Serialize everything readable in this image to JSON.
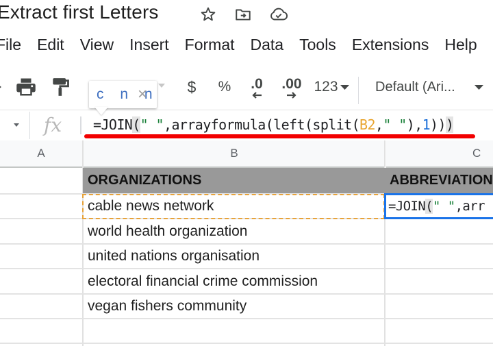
{
  "document": {
    "title": "Extract first Letters",
    "title_icons": [
      "star-icon",
      "move-to-folder-icon",
      "cloud-saved-icon"
    ]
  },
  "menu": {
    "items": [
      "File",
      "Edit",
      "View",
      "Insert",
      "Format",
      "Data",
      "Tools",
      "Extensions",
      "Help"
    ]
  },
  "toolbar": {
    "currency_label": "$",
    "percent_label": "%",
    "decrease_decimal_label": ".0",
    "increase_decimal_label": ".00",
    "number_format_label": "123",
    "font_label": "Default (Ari..."
  },
  "formula_tooltip": {
    "preview": "c n n",
    "close_label": "×"
  },
  "formula_bar": {
    "fx_label": "fx",
    "formula": "=JOIN(\" \",arrayformula(left(split(B2,\" \"),1)))",
    "parts": {
      "p1": "=JOIN",
      "p2": "(",
      "p3": "\" \"",
      "p4": ",arrayformula(left(split(",
      "p5": "B2",
      "p6": ",",
      "p7": "\" \"",
      "p8": "),",
      "p9": "1",
      "p10": "))",
      "p11": ")"
    }
  },
  "sheet": {
    "columns": [
      "A",
      "B",
      "C"
    ],
    "header_row": {
      "B": "ORGANIZATIONS",
      "C": "ABBREVIATIONS"
    },
    "rows": [
      {
        "B": "cable news network",
        "C": "=JOIN(\" \",arrayformula(left(split(B2,\" \"),1)))"
      },
      {
        "B": "world health organization",
        "C": ""
      },
      {
        "B": "united nations organisation",
        "C": ""
      },
      {
        "B": "electoral financial crime commission",
        "C": ""
      },
      {
        "B": "vegan fishers community",
        "C": ""
      },
      {
        "B": "",
        "C": ""
      }
    ],
    "active_cell_display": {
      "c1": "=JOIN",
      "c2": "(",
      "c3": "\" \"",
      "c4": ",arr"
    }
  },
  "colors": {
    "header_fill": "#999999",
    "active_border": "#1a73e8",
    "copy_border": "#e8a33a",
    "annotation_underline": "#f20000",
    "string_token": "#188038",
    "reference_token": "#e8a530",
    "number_token": "#1a6ed8"
  }
}
